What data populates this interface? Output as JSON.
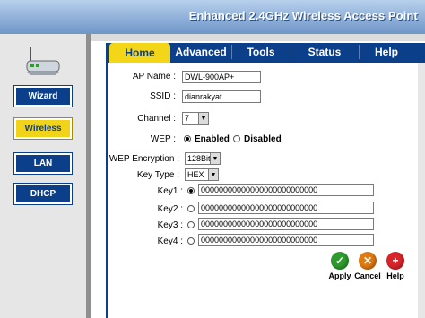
{
  "header": {
    "title": "Enhanced 2.4GHz Wireless Access Point"
  },
  "sidebar": {
    "items": [
      {
        "label": "Wizard",
        "active": false
      },
      {
        "label": "Wireless",
        "active": true
      },
      {
        "label": "LAN",
        "active": false
      },
      {
        "label": "DHCP",
        "active": false
      }
    ]
  },
  "tabs": [
    {
      "label": "Home",
      "active": true
    },
    {
      "label": "Advanced",
      "active": false
    },
    {
      "label": "Tools",
      "active": false
    },
    {
      "label": "Status",
      "active": false
    },
    {
      "label": "Help",
      "active": false
    }
  ],
  "form": {
    "ap_name": {
      "label": "AP Name :",
      "value": "DWL-900AP+"
    },
    "ssid": {
      "label": "SSID :",
      "value": "dianrakyat"
    },
    "channel": {
      "label": "Channel :",
      "value": "7"
    },
    "wep": {
      "label": "WEP :",
      "enabled_label": "Enabled",
      "disabled_label": "Disabled",
      "selected": "Enabled"
    },
    "wep_encryption": {
      "label": "WEP Encryption :",
      "value": "128Bit"
    },
    "key_type": {
      "label": "Key Type :",
      "value": "HEX"
    },
    "keys": [
      {
        "label": "Key1 :",
        "value": "00000000000000000000000000",
        "selected": true
      },
      {
        "label": "Key2 :",
        "value": "00000000000000000000000000",
        "selected": false
      },
      {
        "label": "Key3 :",
        "value": "00000000000000000000000000",
        "selected": false
      },
      {
        "label": "Key4 :",
        "value": "00000000000000000000000000",
        "selected": false
      }
    ]
  },
  "actions": {
    "apply": "Apply",
    "cancel": "Cancel",
    "help": "Help"
  },
  "colors": {
    "navy": "#0c3f8a",
    "yellow": "#f2d617",
    "apply_green": "#2e9b2e",
    "cancel_orange": "#e07a12",
    "help_red": "#d8232a"
  }
}
